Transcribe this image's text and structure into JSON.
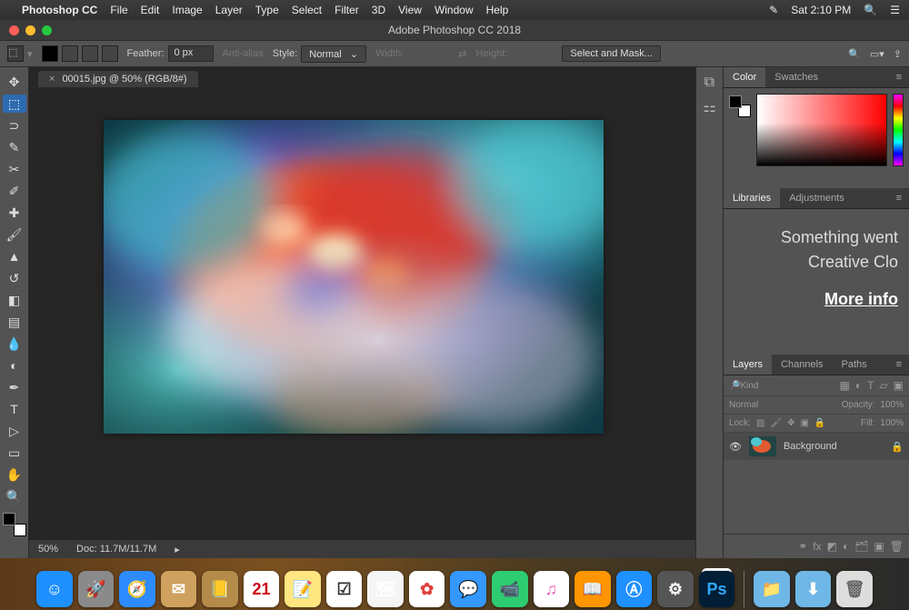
{
  "menubar": {
    "app": "Photoshop CC",
    "items": [
      "File",
      "Edit",
      "Image",
      "Layer",
      "Type",
      "Select",
      "Filter",
      "3D",
      "View",
      "Window",
      "Help"
    ],
    "time": "Sat 2:10 PM"
  },
  "window": {
    "title": "Adobe Photoshop CC 2018"
  },
  "options_bar": {
    "feather_label": "Feather:",
    "feather_value": "0 px",
    "antialias_label": "Anti-alias",
    "style_label": "Style:",
    "style_value": "Normal",
    "width_label": "Width:",
    "height_label": "Height:",
    "select_mask_btn": "Select and Mask..."
  },
  "document": {
    "tab_label": "00015.jpg @ 50% (RGB/8#)",
    "zoom": "50%",
    "doc_size": "Doc: 11.7M/11.7M"
  },
  "tools": [
    {
      "name": "move-tool",
      "glyph": "✥"
    },
    {
      "name": "marquee-tool",
      "glyph": "⬚",
      "active": true
    },
    {
      "name": "lasso-tool",
      "glyph": "⊃"
    },
    {
      "name": "quick-select-tool",
      "glyph": "✎"
    },
    {
      "name": "crop-tool",
      "glyph": "✂"
    },
    {
      "name": "eyedropper-tool",
      "glyph": "✐"
    },
    {
      "name": "healing-brush-tool",
      "glyph": "✚"
    },
    {
      "name": "brush-tool",
      "glyph": "🖌"
    },
    {
      "name": "clone-stamp-tool",
      "glyph": "▲"
    },
    {
      "name": "history-brush-tool",
      "glyph": "↺"
    },
    {
      "name": "eraser-tool",
      "glyph": "◧"
    },
    {
      "name": "gradient-tool",
      "glyph": "▤"
    },
    {
      "name": "blur-tool",
      "glyph": "💧"
    },
    {
      "name": "dodge-tool",
      "glyph": "◐"
    },
    {
      "name": "pen-tool",
      "glyph": "✒"
    },
    {
      "name": "type-tool",
      "glyph": "T"
    },
    {
      "name": "path-select-tool",
      "glyph": "▷"
    },
    {
      "name": "shape-tool",
      "glyph": "▭"
    },
    {
      "name": "hand-tool",
      "glyph": "✋"
    },
    {
      "name": "zoom-tool",
      "glyph": "🔍"
    }
  ],
  "panels": {
    "color": {
      "tabs": [
        "Color",
        "Swatches"
      ],
      "active": 0
    },
    "libraries": {
      "tabs": [
        "Libraries",
        "Adjustments"
      ],
      "active": 0,
      "message_line1": "Something went",
      "message_line2": "Creative Clo",
      "more_info": "More info"
    },
    "layers": {
      "tabs": [
        "Layers",
        "Channels",
        "Paths"
      ],
      "active": 0,
      "kind_placeholder": "Kind",
      "blend_mode": "Normal",
      "opacity_label": "Opacity:",
      "opacity_value": "100%",
      "lock_label": "Lock:",
      "fill_label": "Fill:",
      "fill_value": "100%",
      "rows": [
        {
          "name": "Background",
          "locked": true
        }
      ]
    }
  },
  "dock": {
    "apps": [
      {
        "name": "finder",
        "bg": "#1e90ff",
        "glyph": "☺"
      },
      {
        "name": "launchpad",
        "bg": "#8a8a8a",
        "glyph": "🚀"
      },
      {
        "name": "safari",
        "bg": "#2e8bff",
        "glyph": "🧭"
      },
      {
        "name": "mail",
        "bg": "#cfa15e",
        "glyph": "✉"
      },
      {
        "name": "contacts",
        "bg": "#b58b4a",
        "glyph": "📒"
      },
      {
        "name": "calendar",
        "bg": "#fff",
        "glyph": "21",
        "text": "#d0021b"
      },
      {
        "name": "notes",
        "bg": "#ffe680",
        "glyph": "📝"
      },
      {
        "name": "reminders",
        "bg": "#fff",
        "glyph": "☑",
        "text": "#333"
      },
      {
        "name": "maps",
        "bg": "#f5f5f5",
        "glyph": "🗺"
      },
      {
        "name": "photos",
        "bg": "#fff",
        "glyph": "✿",
        "text": "#e04040"
      },
      {
        "name": "messages",
        "bg": "#3498ff",
        "glyph": "💬"
      },
      {
        "name": "facetime",
        "bg": "#2ecc71",
        "glyph": "📹"
      },
      {
        "name": "itunes",
        "bg": "#fff",
        "glyph": "♫",
        "text": "#e85fb4"
      },
      {
        "name": "ibooks",
        "bg": "#ff9500",
        "glyph": "📖"
      },
      {
        "name": "appstore",
        "bg": "#1e90ff",
        "glyph": "Ⓐ"
      },
      {
        "name": "settings",
        "bg": "#555",
        "glyph": "⚙"
      },
      {
        "name": "photoshop",
        "bg": "#001e36",
        "glyph": "Ps",
        "text": "#31a8ff",
        "active": true
      }
    ],
    "right": [
      {
        "name": "documents-folder",
        "bg": "#6fb7e6",
        "glyph": "📁"
      },
      {
        "name": "downloads-folder",
        "bg": "#6fb7e6",
        "glyph": "⬇"
      },
      {
        "name": "trash",
        "bg": "#ddd",
        "glyph": "🗑",
        "text": "#666"
      }
    ]
  }
}
